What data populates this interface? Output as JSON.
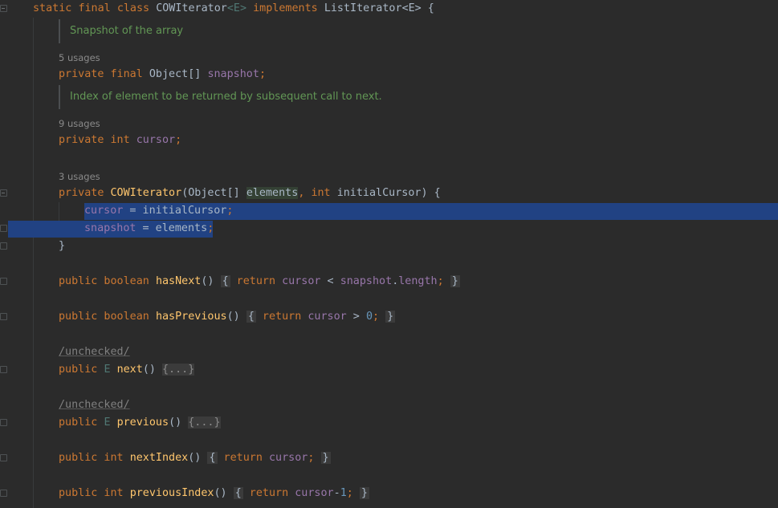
{
  "class_decl": {
    "static": "static",
    "final": "final",
    "class": "class",
    "name": "COWIterator",
    "type_param": "<E>",
    "implements": "implements",
    "iface": "ListIterator",
    "iface_param": "<E>",
    "open": " {"
  },
  "doc_snapshot": "Snapshot of the array",
  "usages_snapshot": "5 usages",
  "field_snapshot": {
    "mods": "private final ",
    "type": "Object[] ",
    "name": "snapshot",
    "semi": ";"
  },
  "doc_cursor": "Index of element to be returned by subsequent call to next.",
  "usages_cursor": "9 usages",
  "field_cursor": {
    "mods": "private int ",
    "name": "cursor",
    "semi": ";"
  },
  "usages_ctor": "3 usages",
  "ctor": {
    "mods": "private ",
    "name": "COWIterator",
    "open": "(Object[] ",
    "p1": "elements",
    "comma": ", ",
    "int": "int ",
    "p2": "initialCursor) {"
  },
  "ctor_body": [
    {
      "field": "cursor",
      "op": " = initialCursor",
      "semi": ";"
    },
    {
      "field": "snapshot",
      "op": " = elements",
      "semi": ";"
    }
  ],
  "ctor_close": "}",
  "methods": {
    "hasNext": {
      "mods": "public boolean ",
      "name": "hasNext",
      "paren": "() ",
      "ob": "{",
      "ret": " return ",
      "f1": "cursor",
      "mid": " < ",
      "f2": "snapshot",
      "dot": ".",
      "len": "length",
      "semi": ";",
      "cb": "}"
    },
    "hasPrevious": {
      "mods": "public boolean ",
      "name": "hasPrevious",
      "paren": "() ",
      "ob": "{",
      "ret": " return ",
      "f1": "cursor",
      "mid": " > ",
      "num": "0",
      "semi": ";",
      "cb": "}"
    },
    "next": {
      "anno": "/unchecked/",
      "mods": "public ",
      "tp": "E ",
      "name": "next",
      "paren": "() ",
      "body": "{...}"
    },
    "previous": {
      "anno": "/unchecked/",
      "mods": "public ",
      "tp": "E ",
      "name": "previous",
      "paren": "() ",
      "body": "{...}"
    },
    "nextIndex": {
      "mods": "public int ",
      "name": "nextIndex",
      "paren": "() ",
      "ob": "{",
      "ret": " return ",
      "f1": "cursor",
      "semi": ";",
      "cb": "}"
    },
    "previousIndex": {
      "mods": "public int ",
      "name": "previousIndex",
      "paren": "() ",
      "ob": "{",
      "ret": " return ",
      "f1": "cursor",
      "minus": "-",
      "num": "1",
      "semi": ";",
      "cb": "}"
    }
  }
}
